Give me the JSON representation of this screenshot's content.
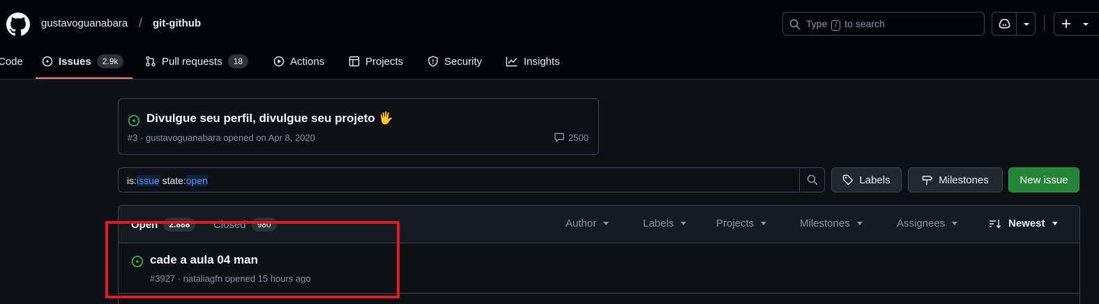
{
  "header": {
    "owner": "gustavoguanabara",
    "separator": "/",
    "repo": "git-github",
    "search": {
      "before": "Type",
      "key": "/",
      "after": "to search"
    }
  },
  "tabs": [
    {
      "label": "Code",
      "icon": "code-icon"
    },
    {
      "label": "Issues",
      "count": "2.9k",
      "icon": "issue-opened-icon",
      "active": true
    },
    {
      "label": "Pull requests",
      "count": "18",
      "icon": "git-pull-request-icon"
    },
    {
      "label": "Actions",
      "icon": "play-icon"
    },
    {
      "label": "Projects",
      "icon": "table-icon"
    },
    {
      "label": "Security",
      "icon": "shield-icon"
    },
    {
      "label": "Insights",
      "icon": "graph-icon"
    }
  ],
  "pinned": {
    "title": "Divulgue seu perfil, divulgue seu projeto",
    "emoji": "🖐",
    "meta": "#3 · gustavoguanabara opened on Apr 8, 2020",
    "comments": "2500"
  },
  "filter": {
    "parts": [
      {
        "text": "is:",
        "hl": false
      },
      {
        "text": "issue",
        "hl": true
      },
      {
        "text": " state:",
        "hl": false
      },
      {
        "text": "open",
        "hl": true
      }
    ]
  },
  "buttons": {
    "labels": "Labels",
    "milestones": "Milestones",
    "new_issue": "New issue"
  },
  "list_header": {
    "open_label": "Open",
    "open_count": "2.888",
    "closed_label": "Closed",
    "closed_count": "980",
    "filters": [
      "Author",
      "Labels",
      "Projects",
      "Milestones",
      "Assignees"
    ],
    "sort": "Newest"
  },
  "issues": [
    {
      "title": "cade a aula 04 man",
      "meta": "#3927 · nataliagfn opened 15 hours ago"
    }
  ],
  "colors": {
    "accent_underline": "#f78166",
    "open_green": "#3fb950",
    "primary_button": "#238636",
    "annotation_box": "#e01b24"
  }
}
